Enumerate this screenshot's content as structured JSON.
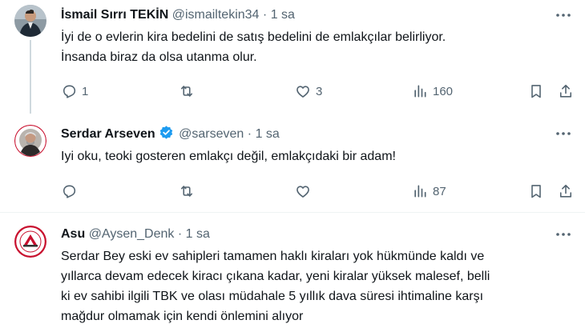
{
  "tweets": [
    {
      "name": "İsmail Sırrı TEKİN",
      "handle": "@ismailtekin34",
      "sep": "·",
      "time": "1 sa",
      "text_lines": [
        "İyi de o evlerin kira bedelini de satış bedelini de emlakçılar belirliyor.",
        "İnsanda biraz da olsa utanma olur."
      ],
      "replies": "1",
      "retweets": "",
      "likes": "3",
      "views": "160"
    },
    {
      "name": "Serdar Arseven",
      "handle": "@sarseven",
      "sep": "·",
      "time": "1 sa",
      "verified": true,
      "text_lines": [
        "Iyi oku, teoki gosteren emlakçı değil, emlakçıdaki bir adam!"
      ],
      "replies": "",
      "retweets": "",
      "likes": "",
      "views": "87"
    },
    {
      "name": "Asu",
      "handle": "@Aysen_Denk",
      "sep": "·",
      "time": "1 sa",
      "text_lines": [
        "Serdar Bey eski ev sahipleri tamamen haklı kiraları yok hükmünde kaldı ve",
        "yıllarca devam edecek kiracı çıkana kadar, yeni kiralar yüksek malesef, belli",
        "ki ev sahibi ilgili TBK ve olası müdahale 5 yıllık dava süresi  ihtimaline karşı",
        "mağdur olmamak için kendi önlemini alıyor"
      ]
    }
  ],
  "icons": {
    "reply": "reply-icon",
    "retweet": "retweet-icon",
    "like": "heart-icon",
    "views": "views-icon",
    "bookmark": "bookmark-icon",
    "share": "share-icon",
    "more": "more-icon",
    "verified": "verified-badge-icon"
  },
  "colors": {
    "text": "#0f1419",
    "muted": "#536471",
    "verified": "#1d9bf0",
    "divider": "#eff3f4",
    "thread_line": "#cfd9de"
  }
}
